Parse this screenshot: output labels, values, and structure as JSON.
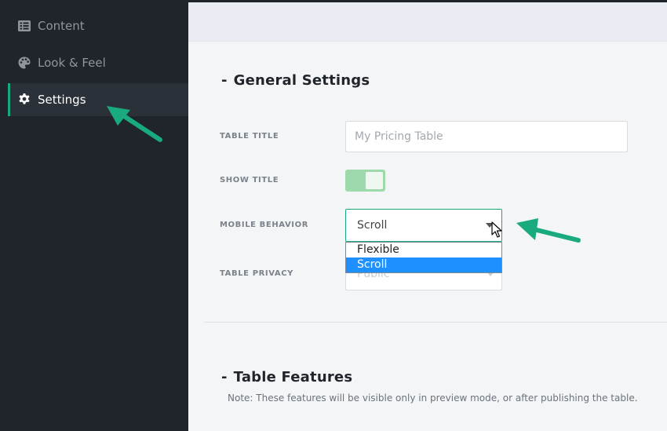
{
  "sidebar": {
    "items": [
      {
        "label": "Content",
        "icon": "list-icon",
        "active": false
      },
      {
        "label": "Look & Feel",
        "icon": "palette-icon",
        "active": false
      },
      {
        "label": "Settings",
        "icon": "gear-icon",
        "active": true
      }
    ]
  },
  "general": {
    "title": "General Settings",
    "table_title": {
      "label": "TABLE TITLE",
      "placeholder": "My Pricing Table",
      "value": ""
    },
    "show_title": {
      "label": "SHOW TITLE",
      "on": true
    },
    "mobile_behavior": {
      "label": "MOBILE BEHAVIOR",
      "value": "Scroll",
      "options": [
        "Flexible",
        "Scroll"
      ]
    },
    "table_privacy": {
      "label": "TABLE PRIVACY",
      "value": "Public"
    }
  },
  "features": {
    "title": "Table Features",
    "note": "Note: These features will be visible only in preview mode, or after publishing the table."
  },
  "colors": {
    "sidebar_bg": "#1f252b",
    "accent": "#19a77e",
    "toggle_on": "#9ed9ac",
    "selected_option": "#1e90ff",
    "annotation_arrow": "#1aaa7f"
  }
}
